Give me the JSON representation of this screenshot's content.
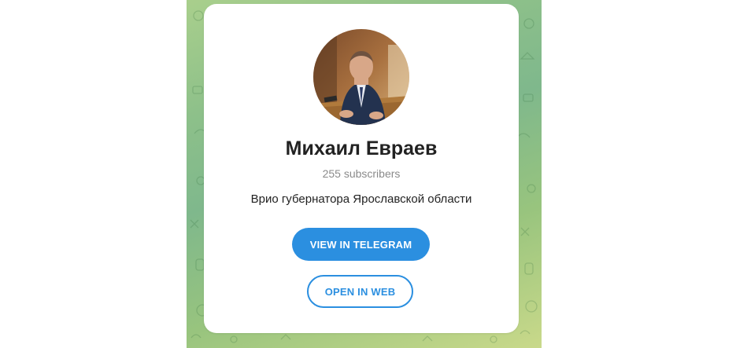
{
  "channel": {
    "name": "Михаил Евраев",
    "subscribers": "255 subscribers",
    "description": "Врио губернатора Ярославской области"
  },
  "actions": {
    "view_in_telegram": "VIEW IN TELEGRAM",
    "open_in_web": "OPEN IN WEB"
  },
  "colors": {
    "accent": "#2b8fe0",
    "background_green": "#8dc08a",
    "card": "#ffffff"
  }
}
